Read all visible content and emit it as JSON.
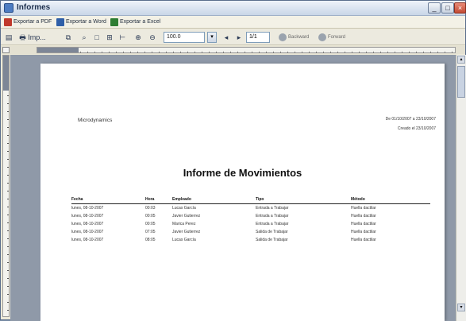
{
  "window": {
    "title": "Informes"
  },
  "export_bar": [
    {
      "label": "Exportar a PDF",
      "icon": "pdf-icon",
      "color": "#c0392b"
    },
    {
      "label": "Exportar a Word",
      "icon": "word-icon",
      "color": "#2f5fa8"
    },
    {
      "label": "Exportar a Excel",
      "icon": "excel-icon",
      "color": "#2e7d32"
    }
  ],
  "toolbar": {
    "print_label": "Imp...",
    "zoom_value": "100.0",
    "page_value": "1/1",
    "backward_label": "Backward",
    "forward_label": "Forward"
  },
  "report": {
    "company": "Microdynamics",
    "range": "De 01/10/2007 a 23/10/2007",
    "created": "Creado el 23/10/2007",
    "title": "Informe de Movimientos",
    "columns": [
      "Fecha",
      "Hora",
      "Empleado",
      "Tipo",
      "Método"
    ],
    "rows": [
      [
        "lunes, 08-10-2007",
        "00:03",
        "Lucas García",
        "Entrada a Trabajar",
        "Huella dactilar"
      ],
      [
        "lunes, 08-10-2007",
        "00:05",
        "Javier Gutierrez",
        "Entrada a Trabajar",
        "Huella dactilar"
      ],
      [
        "lunes, 08-10-2007",
        "00:05",
        "Marica Perez",
        "Entrada a Trabajar",
        "Huella dactilar"
      ],
      [
        "lunes, 08-10-2007",
        "07:05",
        "Javier Gutierrez",
        "Salida de Trabajar",
        "Huella dactilar"
      ],
      [
        "lunes, 08-10-2007",
        "08:05",
        "Lucas García",
        "Salida de Trabajar",
        "Huella dactilar"
      ]
    ]
  }
}
